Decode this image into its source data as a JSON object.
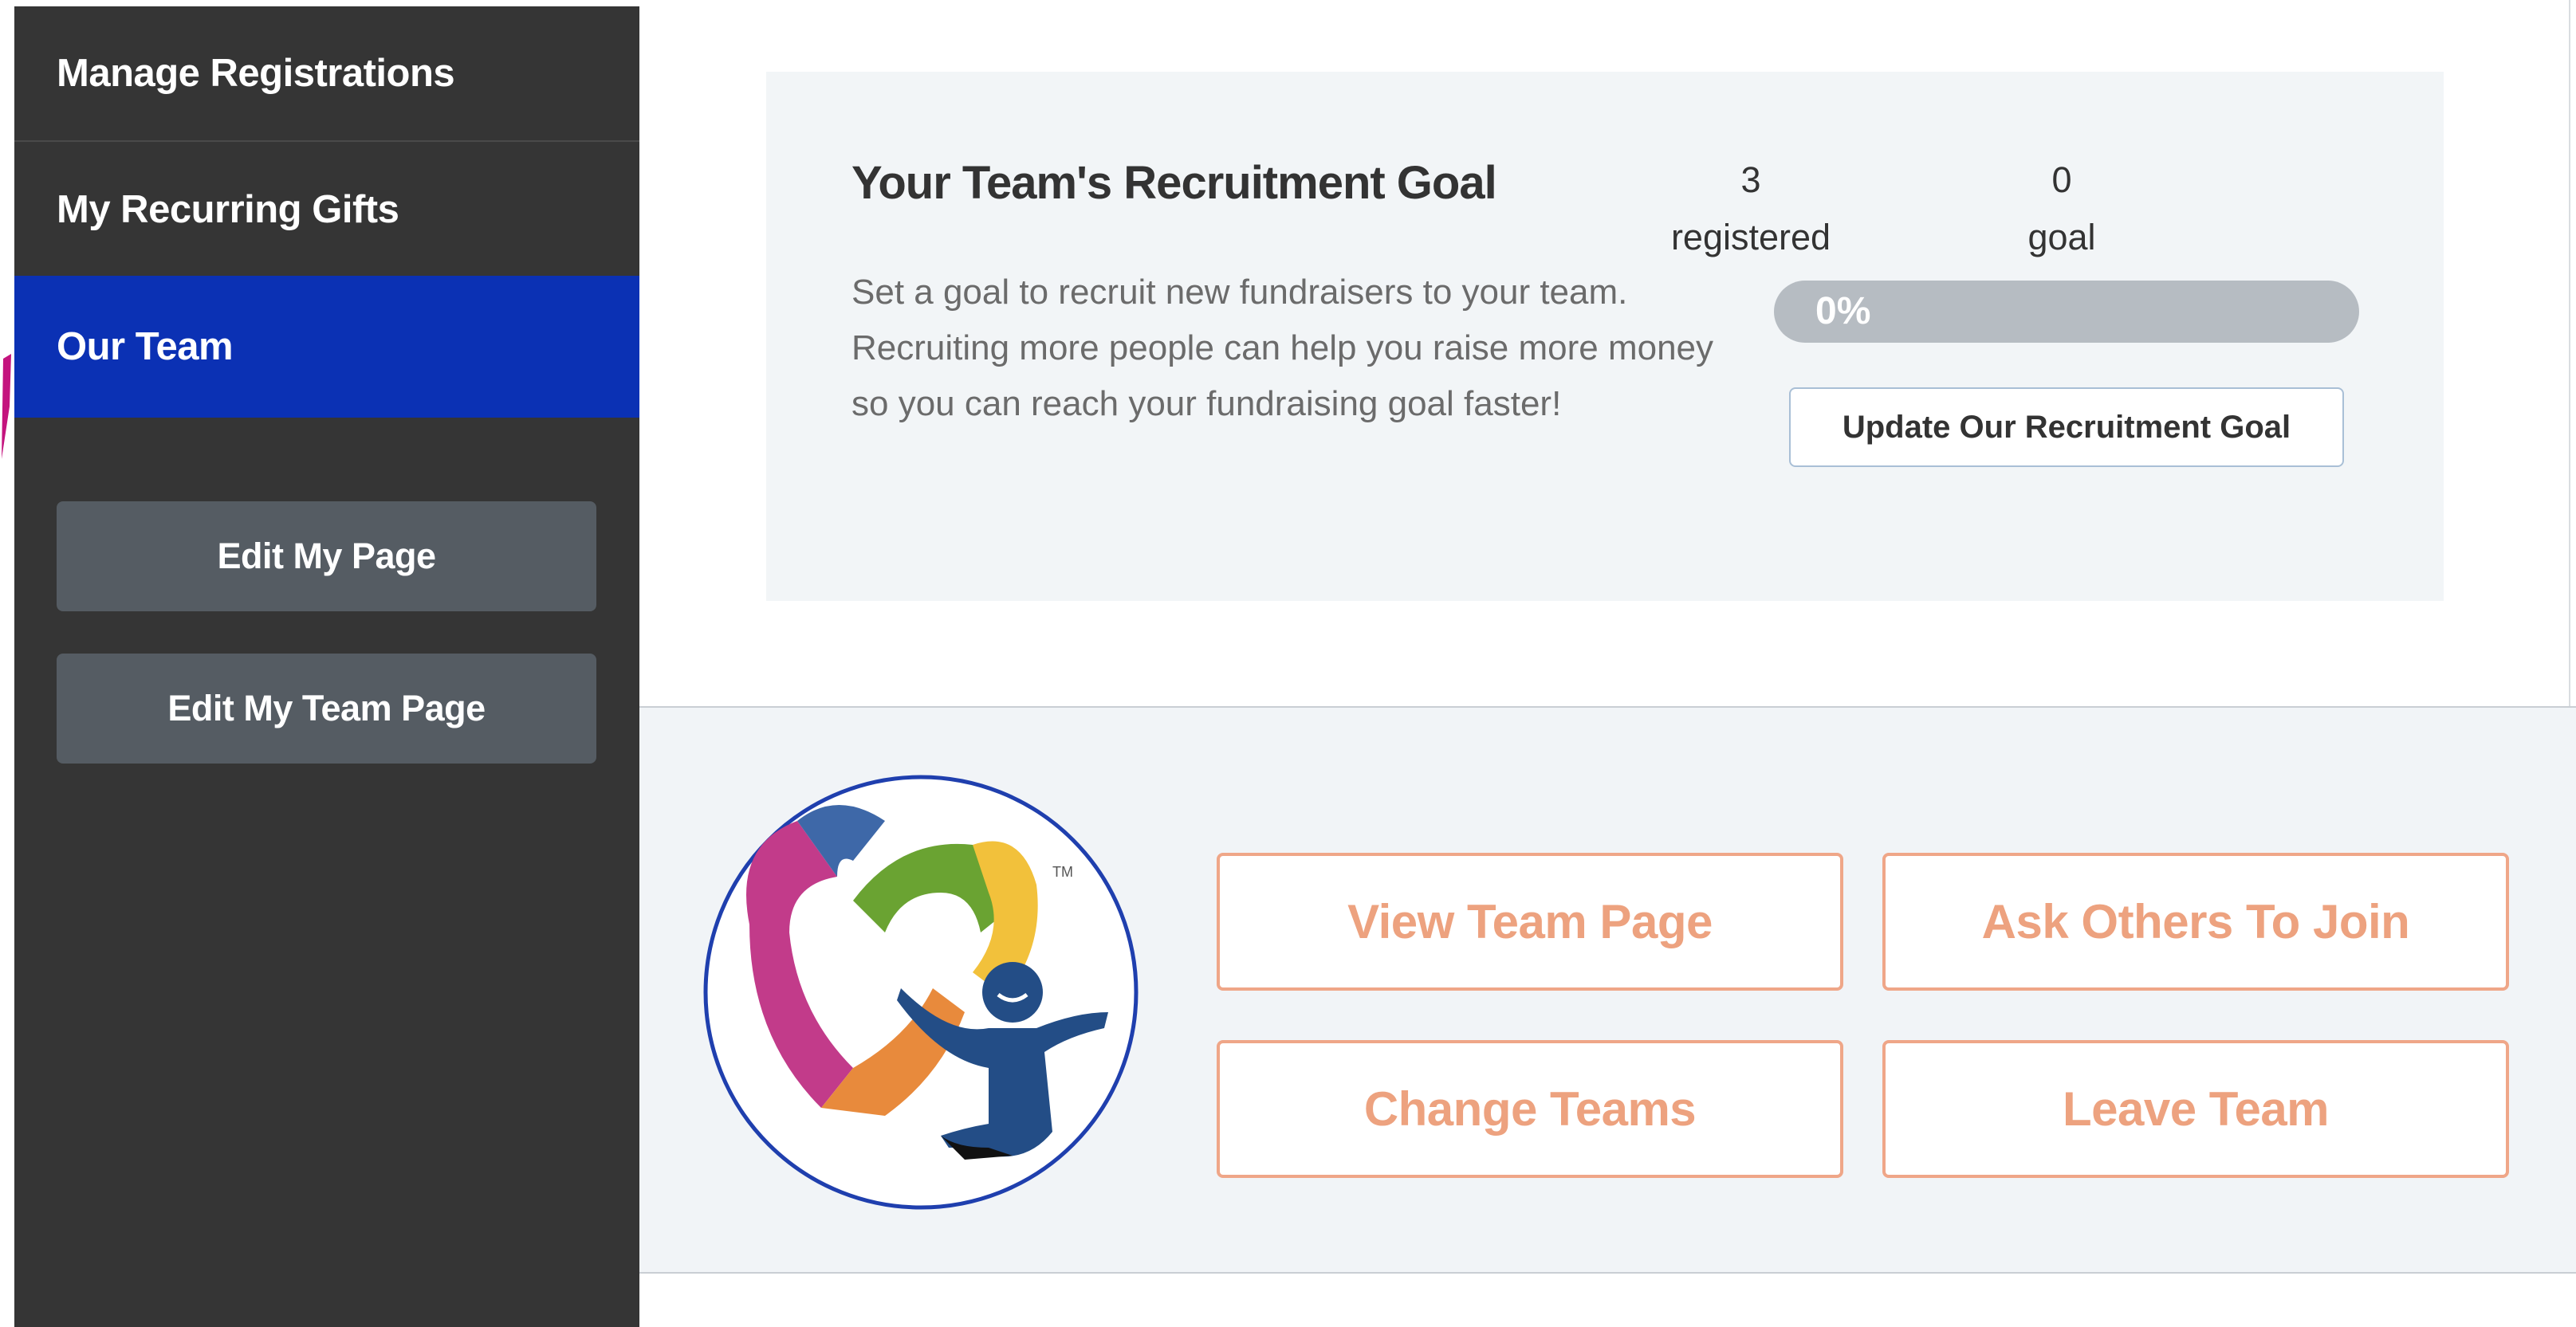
{
  "sidebar": {
    "nav": [
      {
        "label": "Manage Registrations",
        "active": false
      },
      {
        "label": "My Recurring Gifts",
        "active": false
      },
      {
        "label": "Our Team",
        "active": true
      }
    ],
    "buttons": [
      {
        "label": "Edit My Page"
      },
      {
        "label": "Edit My Team Page"
      }
    ]
  },
  "recruitment": {
    "title": "Your Team's Recruitment Goal",
    "description": "Set a goal to recruit new fundraisers to your team. Recruiting more people can help you raise more money so you can reach your fundraising goal faster!",
    "registered_count": "3",
    "registered_label": "registered",
    "goal_count": "0",
    "goal_label": "goal",
    "progress_percent": 0,
    "progress_text": "0%",
    "update_button": "Update Our Recruitment Goal"
  },
  "team": {
    "logo_icon": "heart-person-logo-icon",
    "logo_mark": "TM",
    "actions": {
      "view_team_page": "View Team Page",
      "ask_others": "Ask Others To Join",
      "change_teams": "Change Teams",
      "leave_team": "Leave Team"
    }
  },
  "colors": {
    "sidebar_bg": "#353535",
    "active_nav": "#0b31b4",
    "action_accent": "#efa688",
    "panel_bg": "#f2f5f7"
  }
}
